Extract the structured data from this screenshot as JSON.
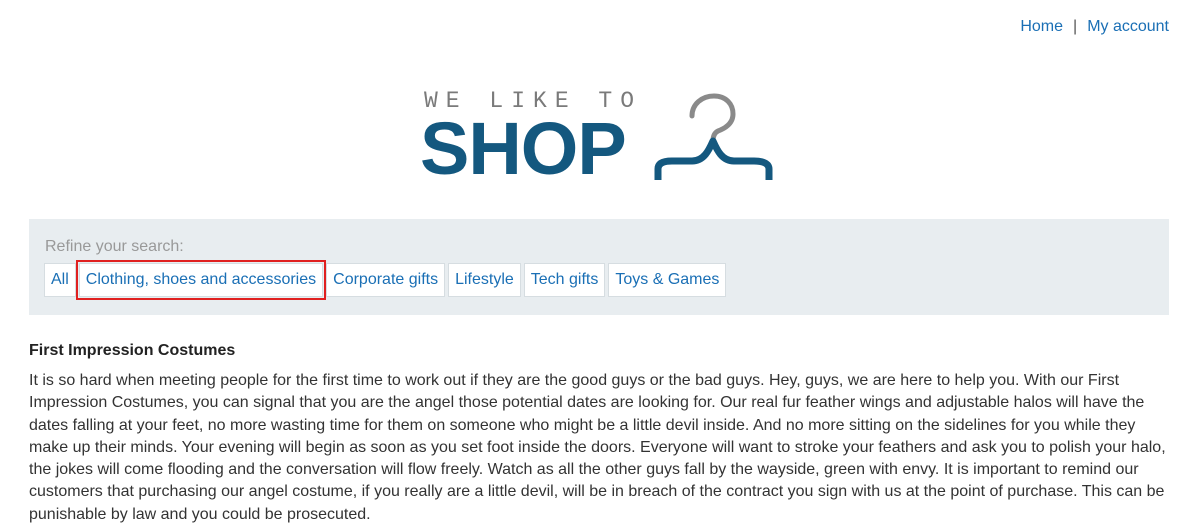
{
  "header": {
    "links": [
      {
        "label": "Home"
      },
      {
        "label": "My account"
      }
    ],
    "separator": "|"
  },
  "logo": {
    "tagline": "WE LIKE TO",
    "word": "SHOP",
    "icon": "hanger-icon",
    "colors": {
      "word": "#14587f",
      "tagline": "#7a7a7a",
      "hook": "#8a8a8a"
    }
  },
  "refine": {
    "label": "Refine your search:",
    "filters": [
      {
        "label": "All"
      },
      {
        "label": "Clothing, shoes and accessories",
        "highlighted": true
      },
      {
        "label": "Corporate gifts"
      },
      {
        "label": "Lifestyle"
      },
      {
        "label": "Tech gifts"
      },
      {
        "label": "Toys & Games"
      }
    ]
  },
  "product": {
    "title": "First Impression Costumes",
    "description": "It is so hard when meeting people for the first time to work out if they are the good guys or the bad guys. Hey, guys, we are here to help you. With our First Impression Costumes, you can signal that you are the angel those potential dates are looking for. Our real fur feather wings and adjustable halos will have the dates falling at your feet, no more wasting time for them on someone who might be a little devil inside. And no more sitting on the sidelines for you while they make up their minds. Your evening will begin as soon as you set foot inside the doors. Everyone will want to stroke your feathers and ask you to polish your halo, the jokes will come flooding and the conversation will flow freely. Watch as all the other guys fall by the wayside, green with envy. It is important to remind our customers that purchasing our angel costume, if you really are a little devil, will be in breach of the contract you sign with us at the point of purchase. This can be punishable by law and you could be prosecuted."
  },
  "colors": {
    "link": "#1a6fb5",
    "refine_background": "#e8edf0",
    "highlight_outline": "#e02020"
  }
}
